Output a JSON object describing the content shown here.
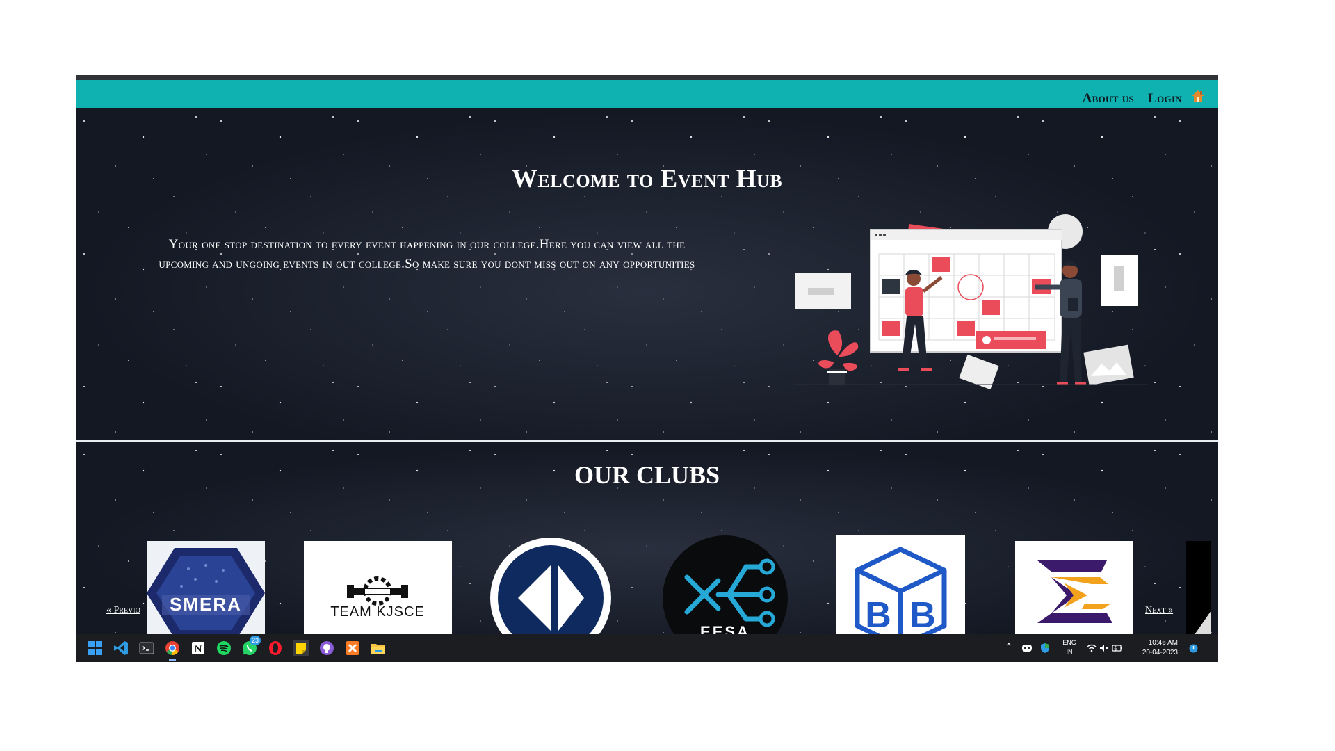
{
  "nav": {
    "about_label": "About us",
    "login_label": "Login",
    "home_icon": "home-icon"
  },
  "hero": {
    "title": "Welcome to Event Hub",
    "text": "Your one stop destination to every event happening in our college.Here you can view all the upcoming and ungoing events in out college.So make sure you dont miss out on any opportunities"
  },
  "clubs": {
    "title": "OUR CLUBS",
    "prev_label": "« Previo",
    "next_label": "Next »",
    "items": [
      {
        "name": "smera",
        "logo_text": "SMERA"
      },
      {
        "name": "team-kjsce",
        "logo_text": "TEAM KJSCE"
      },
      {
        "name": "club-3",
        "logo_text": ""
      },
      {
        "name": "eesa",
        "logo_text": "EESA"
      },
      {
        "name": "bb",
        "logo_text": "BB"
      },
      {
        "name": "sigma",
        "logo_text": ""
      }
    ]
  },
  "taskbar": {
    "apps": [
      "start-icon",
      "vscode-icon",
      "terminal-icon",
      "chrome-icon",
      "notion-icon",
      "spotify-icon",
      "whatsapp-icon",
      "opera-icon",
      "sticky-notes-icon",
      "github-desktop-icon",
      "xampp-icon",
      "file-explorer-icon"
    ],
    "whatsapp_badge": "23",
    "lang_top": "ENG",
    "lang_bottom": "IN",
    "time": "10:46 AM",
    "date": "20-04-2023"
  },
  "colors": {
    "navbar": "#0fb2b0",
    "background": "#131823",
    "accent_red": "#eb4c5a"
  }
}
